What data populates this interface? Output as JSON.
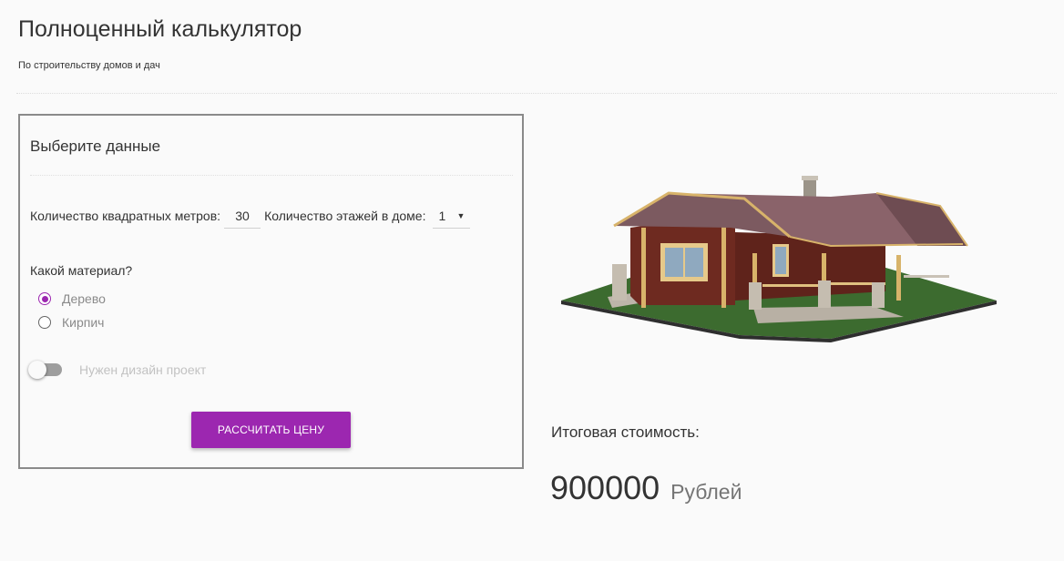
{
  "header": {
    "title": "Полноценный калькулятор",
    "subtitle": "По строительству домов и дач"
  },
  "form": {
    "title": "Выберите данные",
    "sqm_label": "Количество квадратных метров:",
    "sqm_value": "30",
    "floors_label": "Количество этажей в доме:",
    "floors_value": "1",
    "floors_caret_icon": "caret-down-icon",
    "material_label": "Какой материал?",
    "materials": [
      {
        "label": "Дерево",
        "checked": true
      },
      {
        "label": "Кирпич",
        "checked": false
      }
    ],
    "design_toggle": {
      "label": "Нужен дизайн проект",
      "on": false
    },
    "submit_label": "РАССЧИТАТЬ ЦЕНУ"
  },
  "result": {
    "label": "Итоговая стоимость:",
    "value": "900000",
    "unit": "Рублей"
  },
  "colors": {
    "accent": "#9c27b0",
    "border": "#8a8a8a",
    "background": "#fafafa"
  }
}
